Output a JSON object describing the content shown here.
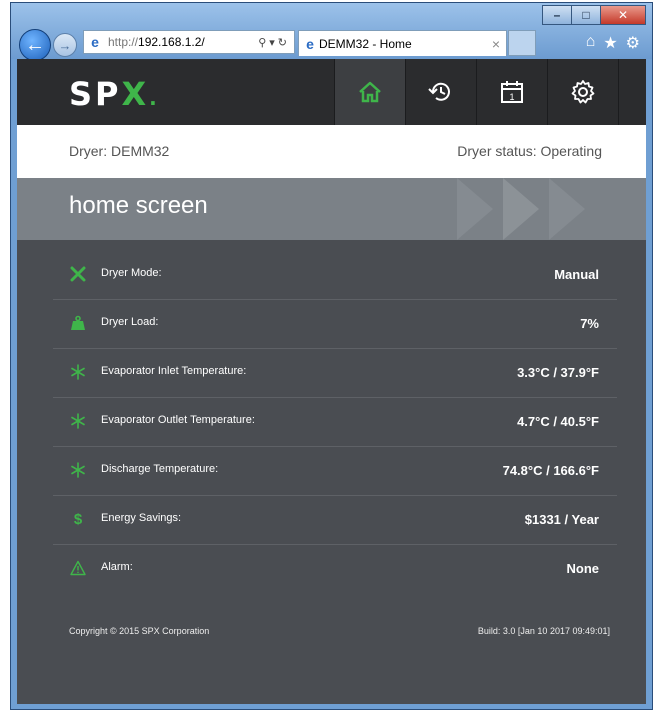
{
  "browser": {
    "address_proto": "http://",
    "address_host": "192.168.1.2/",
    "tab_title": "DEMM32 - Home"
  },
  "header": {
    "logo_main": "SP",
    "logo_accent": "X",
    "nav": [
      "home-icon",
      "history-icon",
      "calendar-icon",
      "gear-icon"
    ],
    "calendar_day": "1"
  },
  "info": {
    "dryer_name": "Dryer: DEMM32",
    "dryer_status": "Dryer status: Operating"
  },
  "banner": {
    "title": "home screen"
  },
  "rows": [
    {
      "icon": "tools-icon",
      "label": "Dryer Mode:",
      "value": "Manual"
    },
    {
      "icon": "weight-icon",
      "label": "Dryer Load:",
      "value": "7%"
    },
    {
      "icon": "snowflake-icon",
      "label": "Evaporator Inlet Temperature:",
      "value": "3.3°C / 37.9°F"
    },
    {
      "icon": "snowflake-icon",
      "label": "Evaporator Outlet Temperature:",
      "value": "4.7°C / 40.5°F"
    },
    {
      "icon": "snowflake-icon",
      "label": "Discharge Temperature:",
      "value": "74.8°C / 166.6°F"
    },
    {
      "icon": "dollar-icon",
      "label": "Energy Savings:",
      "value": "$1331 / Year"
    },
    {
      "icon": "warning-icon",
      "label": "Alarm:",
      "value": "None"
    }
  ],
  "footer": {
    "copyright": "Copyright © 2015 SPX Corporation",
    "build": "Build: 3.0 [Jan 10 2017 09:49:01]"
  },
  "colors": {
    "accent": "#3fb54a",
    "header": "#2b2c2e",
    "panel": "#4a4d52"
  }
}
